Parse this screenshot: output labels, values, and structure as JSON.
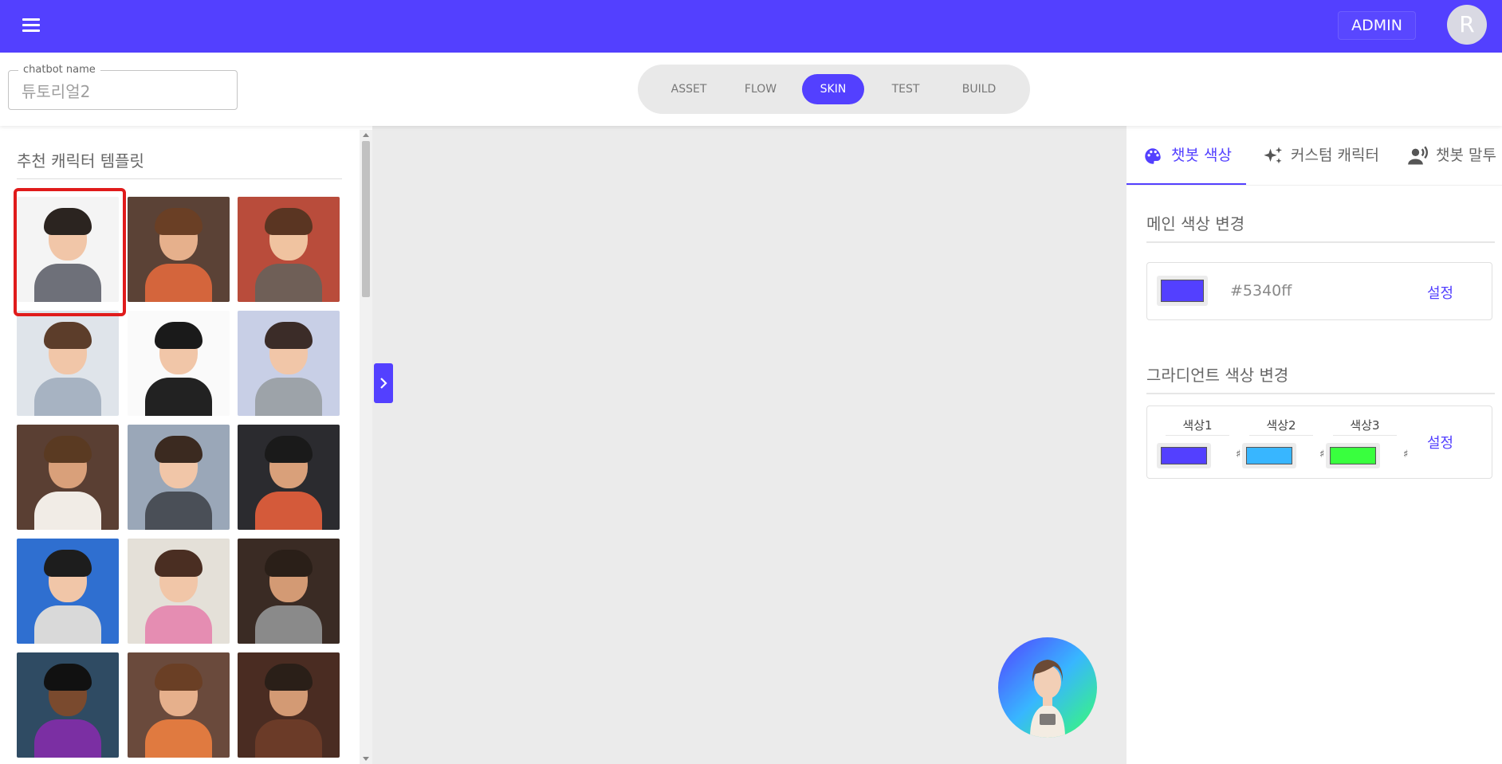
{
  "header": {
    "admin_label": "ADMIN",
    "avatar_letter": "R",
    "brand_color": "#5340ff"
  },
  "toolbar": {
    "chatbot_name_label": "chatbot name",
    "chatbot_name_value": "튜토리얼2",
    "tabs": [
      {
        "label": "ASSET",
        "active": false
      },
      {
        "label": "FLOW",
        "active": false
      },
      {
        "label": "SKIN",
        "active": true
      },
      {
        "label": "TEST",
        "active": false
      },
      {
        "label": "BUILD",
        "active": false
      }
    ]
  },
  "templates": {
    "title": "추천 캐릭터 템플릿",
    "selected_index": 0,
    "item_count": 15
  },
  "right_panel": {
    "tabs": [
      {
        "label": "챗봇 색상",
        "icon": "palette-icon",
        "active": true
      },
      {
        "label": "커스텀 캐릭터",
        "icon": "sparkles-icon",
        "active": false
      },
      {
        "label": "챗봇 말투",
        "icon": "speaking-person-icon",
        "active": false
      }
    ],
    "main_color": {
      "title": "메인 색상 변경",
      "hex": "#5340ff",
      "swatch_color": "#5340ff",
      "set_label": "설정"
    },
    "gradient": {
      "title": "그라디언트 색상 변경",
      "colors": [
        {
          "label": "색상1",
          "color": "#5340ff"
        },
        {
          "label": "색상2",
          "color": "#38b6ff"
        },
        {
          "label": "색상3",
          "color": "#39ff3e"
        }
      ],
      "hash_symbol": "♯",
      "set_label": "설정"
    }
  }
}
